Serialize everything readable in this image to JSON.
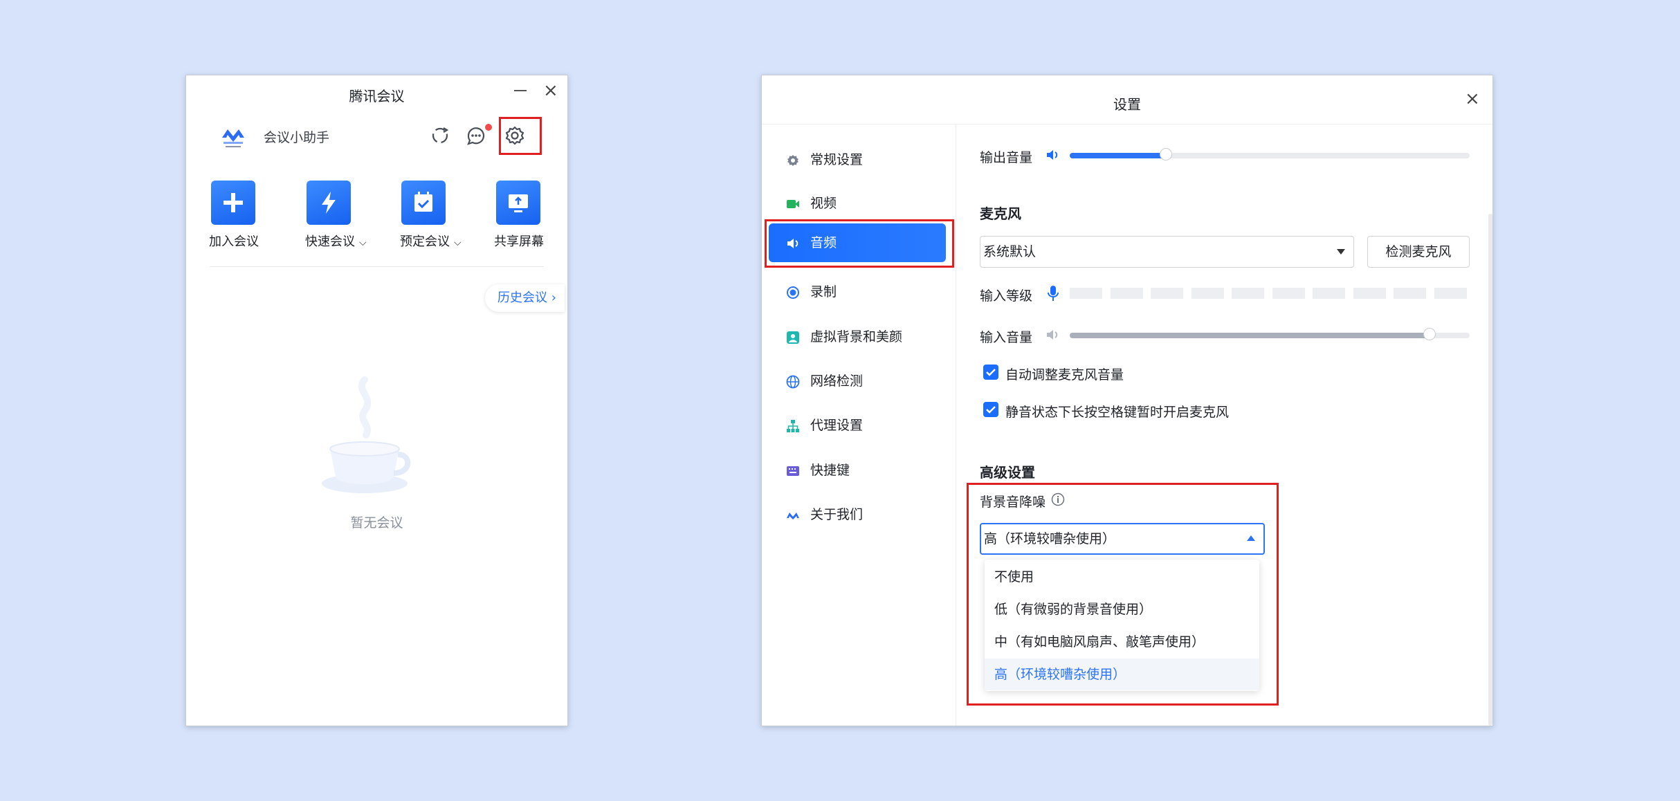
{
  "main_window": {
    "title": "腾讯会议",
    "assistant_label": "会议小助手",
    "tiles": [
      {
        "label": "加入会议",
        "icon": "plus-icon",
        "has_chevron": false
      },
      {
        "label": "快速会议",
        "icon": "lightning-icon",
        "has_chevron": true
      },
      {
        "label": "预定会议",
        "icon": "calendar-check-icon",
        "has_chevron": true
      },
      {
        "label": "共享屏幕",
        "icon": "share-screen-icon",
        "has_chevron": false
      }
    ],
    "history_label": "历史会议",
    "empty_text": "暂无会议",
    "chevron_glyph": "⌵",
    "history_chevron_glyph": "›"
  },
  "settings_window": {
    "title": "设置",
    "nav": [
      {
        "label": "常规设置",
        "icon": "gear-icon"
      },
      {
        "label": "视频",
        "icon": "video-camera-icon"
      },
      {
        "label": "音频",
        "icon": "speaker-icon",
        "active": true
      },
      {
        "label": "录制",
        "icon": "record-icon"
      },
      {
        "label": "虚拟背景和美颜",
        "icon": "portrait-icon"
      },
      {
        "label": "网络检测",
        "icon": "globe-icon"
      },
      {
        "label": "代理设置",
        "icon": "network-tree-icon"
      },
      {
        "label": "快捷键",
        "icon": "keyboard-icon"
      },
      {
        "label": "关于我们",
        "icon": "tencent-meeting-logo-icon"
      }
    ],
    "output_volume_label": "输出音量",
    "output_volume_level": 0.24,
    "mic_section_title": "麦克风",
    "mic_device_value": "系统默认",
    "test_mic_button": "检测麦克风",
    "input_level_label": "输入等级",
    "input_volume_label": "输入音量",
    "input_volume_level": 0.9,
    "auto_adjust_label": "自动调整麦克风音量",
    "auto_adjust_checked": true,
    "space_unmute_label": "静音状态下长按空格键暂时开启麦克风",
    "space_unmute_checked": true,
    "advanced_title": "高级设置",
    "noise_label": "背景音降噪",
    "noise_value": "高（环境较嘈杂使用）",
    "noise_options": [
      "不使用",
      "低（有微弱的背景音使用）",
      "中（有如电脑风扇声、敲笔声使用）",
      "高（环境较嘈杂使用）"
    ],
    "noise_selected_index": 3
  },
  "colors": {
    "background": "#d6e3fb",
    "accent": "#1a6dff",
    "highlight": "#e02020",
    "badge": "#f24b4b"
  }
}
